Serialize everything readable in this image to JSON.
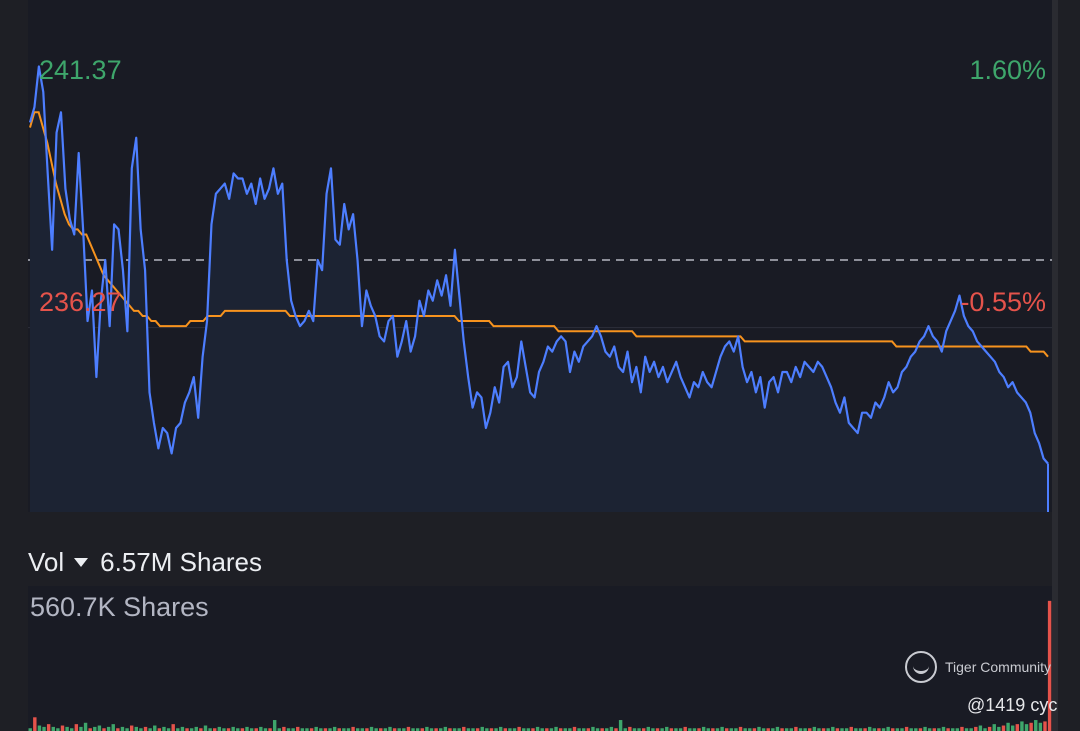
{
  "chart_data": {
    "type": "line",
    "x_positions": 300,
    "series": [
      {
        "role": "price",
        "color": "#4d7eff",
        "values": [
          240.3,
          240.6,
          241.4,
          240.9,
          239.3,
          237.8,
          240.1,
          240.5,
          239.0,
          238.4,
          238.1,
          239.7,
          238.2,
          236.4,
          237.0,
          235.3,
          236.8,
          237.6,
          236.3,
          238.3,
          238.2,
          237.4,
          236.2,
          239.4,
          240.0,
          238.2,
          237.4,
          235.0,
          234.4,
          233.9,
          234.3,
          234.2,
          233.8,
          234.3,
          234.4,
          234.8,
          235.0,
          235.3,
          234.5,
          235.7,
          236.4,
          238.3,
          238.9,
          239.0,
          239.1,
          238.8,
          239.3,
          239.2,
          239.2,
          238.9,
          239.1,
          238.7,
          239.2,
          238.8,
          239.0,
          239.4,
          238.9,
          239.1,
          237.6,
          236.8,
          236.5,
          236.3,
          236.4,
          236.6,
          236.4,
          237.6,
          237.4,
          238.9,
          239.4,
          238.0,
          237.9,
          238.7,
          238.2,
          238.5,
          237.6,
          236.3,
          237.0,
          236.7,
          236.5,
          236.1,
          236.0,
          236.4,
          236.5,
          235.7,
          236.0,
          236.4,
          235.8,
          236.1,
          236.8,
          236.5,
          237.0,
          236.8,
          237.2,
          236.9,
          237.3,
          236.7,
          237.8,
          236.9,
          236.0,
          235.3,
          234.7,
          235.0,
          234.9,
          234.3,
          234.6,
          235.1,
          234.8,
          235.5,
          235.6,
          235.1,
          235.3,
          236.0,
          235.5,
          235.0,
          234.9,
          235.4,
          235.6,
          235.9,
          235.8,
          236.0,
          236.1,
          236.0,
          235.4,
          235.8,
          235.6,
          235.9,
          236.0,
          236.1,
          236.3,
          236.1,
          235.8,
          235.7,
          235.9,
          235.5,
          235.4,
          235.8,
          235.2,
          235.5,
          235.0,
          235.7,
          235.4,
          235.6,
          235.3,
          235.5,
          235.2,
          235.4,
          235.6,
          235.3,
          235.1,
          234.9,
          235.2,
          235.1,
          235.4,
          235.2,
          235.1,
          235.4,
          235.7,
          235.9,
          236.0,
          235.8,
          236.1,
          235.5,
          235.2,
          235.4,
          235.0,
          235.3,
          234.7,
          235.2,
          235.3,
          235.0,
          235.4,
          235.4,
          235.2,
          235.5,
          235.3,
          235.6,
          235.5,
          235.4,
          235.6,
          235.5,
          235.3,
          235.1,
          234.8,
          234.6,
          234.9,
          234.4,
          234.3,
          234.2,
          234.6,
          234.6,
          234.5,
          234.8,
          234.7,
          234.9,
          235.2,
          235.0,
          235.1,
          235.4,
          235.5,
          235.7,
          235.8,
          236.0,
          236.1,
          236.3,
          236.1,
          236.0,
          235.8,
          236.2,
          236.4,
          236.6,
          236.9,
          236.5,
          236.3,
          236.2,
          236.0,
          235.9,
          235.8,
          235.7,
          235.6,
          235.4,
          235.3,
          235.1,
          235.2,
          235.0,
          234.9,
          234.8,
          234.6,
          234.2
        ],
        "values_tail": [
          234.0,
          233.7,
          233.6
        ]
      },
      {
        "role": "average",
        "color": "#f7931e",
        "values": [
          240.2,
          240.5,
          240.5,
          240.2,
          239.9,
          239.5,
          239.1,
          238.8,
          238.5,
          238.3,
          238.2,
          238.2,
          238.1,
          238.1,
          237.9,
          237.7,
          237.5,
          237.3,
          237.2,
          237.1,
          237.0,
          236.9,
          236.8,
          236.7,
          236.6,
          236.6,
          236.5,
          236.5,
          236.4,
          236.4,
          236.3,
          236.3,
          236.3,
          236.3,
          236.3,
          236.3,
          236.3,
          236.4,
          236.4,
          236.4,
          236.4,
          236.5,
          236.5,
          236.5,
          236.5,
          236.6,
          236.6,
          236.6,
          236.6,
          236.6,
          236.6,
          236.6,
          236.6,
          236.6,
          236.6,
          236.6,
          236.6,
          236.6,
          236.6,
          236.6,
          236.5,
          236.5,
          236.5,
          236.5,
          236.5,
          236.5,
          236.5,
          236.5,
          236.5,
          236.5,
          236.5,
          236.5,
          236.5,
          236.5,
          236.5,
          236.5,
          236.5,
          236.5,
          236.5,
          236.5,
          236.5,
          236.5,
          236.5,
          236.5,
          236.5,
          236.5,
          236.5,
          236.5,
          236.5,
          236.5,
          236.5,
          236.5,
          236.5,
          236.5,
          236.5,
          236.5,
          236.5,
          236.5,
          236.5,
          236.4,
          236.4,
          236.4,
          236.4,
          236.4,
          236.4,
          236.4,
          236.4,
          236.3,
          236.3,
          236.3,
          236.3,
          236.3,
          236.3,
          236.3,
          236.3,
          236.3,
          236.3,
          236.3,
          236.3,
          236.3,
          236.3,
          236.3,
          236.2,
          236.2,
          236.2,
          236.2,
          236.2,
          236.2,
          236.2,
          236.2,
          236.2,
          236.2,
          236.2,
          236.2,
          236.2,
          236.2,
          236.2,
          236.2,
          236.2,
          236.2,
          236.1,
          236.1,
          236.1,
          236.1,
          236.1,
          236.1,
          236.1,
          236.1,
          236.1,
          236.1,
          236.1,
          236.1,
          236.1,
          236.1,
          236.1,
          236.1,
          236.1,
          236.1,
          236.1,
          236.1,
          236.1,
          236.1,
          236.1,
          236.1,
          236.1,
          236.0,
          236.0,
          236.0,
          236.0,
          236.0,
          236.0,
          236.0,
          236.0,
          236.0,
          236.0,
          236.0,
          236.0,
          236.0,
          236.0,
          236.0,
          236.0,
          236.0,
          236.0,
          236.0,
          236.0,
          236.0,
          236.0,
          236.0,
          236.0,
          236.0,
          236.0,
          236.0,
          236.0,
          236.0,
          236.0,
          236.0,
          236.0,
          236.0,
          236.0,
          236.0,
          235.9,
          235.9,
          235.9,
          235.9,
          235.9,
          235.9,
          235.9,
          235.9,
          235.9,
          235.9,
          235.9,
          235.9,
          235.9,
          235.9,
          235.9,
          235.9,
          235.9,
          235.9,
          235.9,
          235.9,
          235.9,
          235.9,
          235.9,
          235.9,
          235.9,
          235.9,
          235.9,
          235.9,
          235.9,
          235.9,
          235.9,
          235.8,
          235.8,
          235.8,
          235.8,
          235.7
        ]
      }
    ],
    "y_max_label": "241.37",
    "y_min_label": "236.27",
    "pct_max_label": "1.60%",
    "pct_min_label": "-0.55%",
    "y_max": 241.37,
    "y_min": 232.1,
    "reference_price": 237.6,
    "reference_style": "dashed",
    "colors": {
      "up": "#3ea66b",
      "down": "#e5534b",
      "reference": "#8e909a"
    },
    "volume": {
      "label": "Vol",
      "total": "6.57M Shares",
      "max_label": "560.7K Shares",
      "bars": [
        0.02,
        0.1,
        0.04,
        0.03,
        0.05,
        0.03,
        0.02,
        0.04,
        0.03,
        0.02,
        0.05,
        0.03,
        0.06,
        0.02,
        0.03,
        0.04,
        0.02,
        0.03,
        0.05,
        0.02,
        0.03,
        0.02,
        0.04,
        0.03,
        0.02,
        0.03,
        0.02,
        0.04,
        0.02,
        0.03,
        0.02,
        0.05,
        0.02,
        0.03,
        0.02,
        0.02,
        0.03,
        0.02,
        0.04,
        0.02,
        0.02,
        0.03,
        0.02,
        0.02,
        0.03,
        0.02,
        0.02,
        0.03,
        0.02,
        0.02,
        0.03,
        0.02,
        0.02,
        0.08,
        0.02,
        0.03,
        0.02,
        0.02,
        0.03,
        0.02,
        0.02,
        0.02,
        0.03,
        0.02,
        0.02,
        0.02,
        0.03,
        0.02,
        0.02,
        0.02,
        0.03,
        0.02,
        0.02,
        0.02,
        0.03,
        0.02,
        0.02,
        0.02,
        0.03,
        0.02,
        0.02,
        0.02,
        0.03,
        0.02,
        0.02,
        0.02,
        0.03,
        0.02,
        0.02,
        0.02,
        0.03,
        0.02,
        0.02,
        0.02,
        0.03,
        0.02,
        0.02,
        0.02,
        0.03,
        0.02,
        0.02,
        0.02,
        0.03,
        0.02,
        0.02,
        0.02,
        0.03,
        0.02,
        0.02,
        0.02,
        0.03,
        0.02,
        0.02,
        0.02,
        0.03,
        0.02,
        0.02,
        0.02,
        0.03,
        0.02,
        0.02,
        0.02,
        0.03,
        0.02,
        0.02,
        0.02,
        0.03,
        0.02,
        0.08,
        0.02,
        0.03,
        0.02,
        0.02,
        0.02,
        0.03,
        0.02,
        0.02,
        0.02,
        0.03,
        0.02,
        0.02,
        0.02,
        0.03,
        0.02,
        0.02,
        0.02,
        0.03,
        0.02,
        0.02,
        0.02,
        0.03,
        0.02,
        0.02,
        0.02,
        0.03,
        0.02,
        0.02,
        0.02,
        0.03,
        0.02,
        0.02,
        0.02,
        0.03,
        0.02,
        0.02,
        0.02,
        0.03,
        0.02,
        0.02,
        0.02,
        0.03,
        0.02,
        0.02,
        0.02,
        0.03,
        0.02,
        0.02,
        0.02,
        0.03,
        0.02,
        0.02,
        0.02,
        0.03,
        0.02,
        0.02,
        0.02,
        0.03,
        0.02,
        0.02,
        0.02,
        0.03,
        0.02,
        0.02,
        0.02,
        0.03,
        0.02,
        0.02,
        0.02,
        0.03,
        0.02,
        0.02,
        0.02,
        0.03,
        0.02,
        0.02,
        0.03,
        0.04,
        0.02,
        0.03,
        0.05,
        0.03,
        0.04,
        0.06,
        0.04,
        0.05,
        0.07,
        0.05,
        0.06,
        0.08,
        0.06,
        0.07,
        0.95
      ]
    }
  },
  "watermark": {
    "brand": "Tiger Community",
    "user": "@1419 cyc"
  }
}
